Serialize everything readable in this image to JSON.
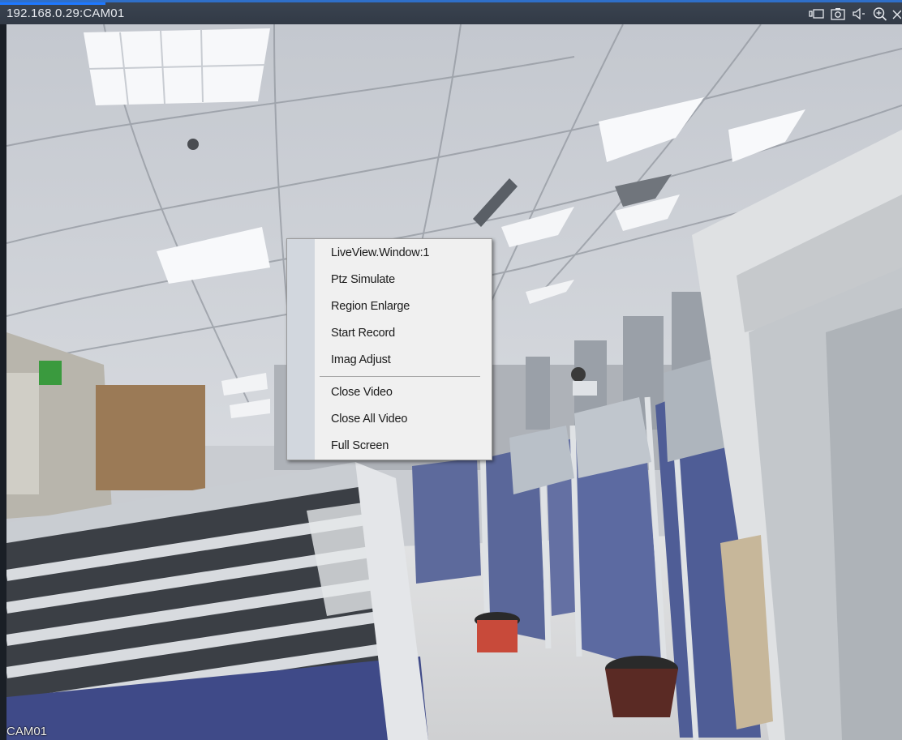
{
  "window": {
    "title": "192.168.0.29:CAM01"
  },
  "toolbar": {
    "icons": [
      "record-icon",
      "snapshot-icon",
      "audio-icon",
      "zoom-in-icon",
      "close-icon"
    ]
  },
  "video": {
    "channel_label": "CAM01"
  },
  "context_menu": {
    "items": [
      "LiveView.Window:1",
      "Ptz Simulate",
      "Region Enlarge",
      "Start Record",
      "Imag Adjust",
      "Close Video",
      "Close All Video",
      "Full Screen"
    ]
  },
  "colors": {
    "titlebar": "#353e4a",
    "accent": "#1e78ff",
    "menu_bg": "#f0f0f0",
    "menu_gutter": "#d2d7de"
  }
}
